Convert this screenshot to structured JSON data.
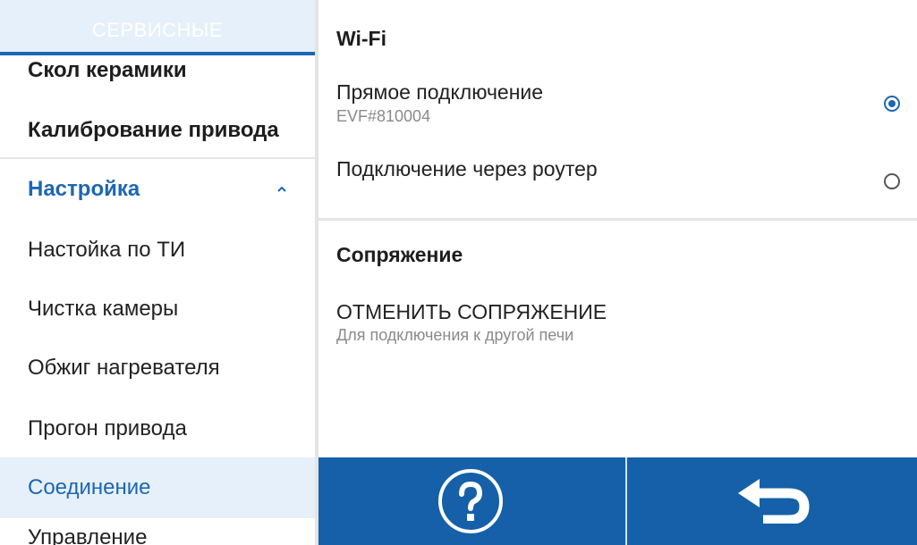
{
  "sidebar": {
    "header": "СЕРВИСНЫЕ",
    "items": [
      {
        "label": "Скол керамики"
      },
      {
        "label": "Калибрование привода"
      },
      {
        "label": "Настройка"
      },
      {
        "label": "Настойка по ТИ"
      },
      {
        "label": "Чистка камеры"
      },
      {
        "label": "Обжиг нагревателя"
      },
      {
        "label": "Прогон привода"
      },
      {
        "label": "Соединение"
      },
      {
        "label": "Управление"
      }
    ]
  },
  "main": {
    "wifi": {
      "title": "Wi-Fi",
      "options": [
        {
          "title": "Прямое подключение",
          "subtitle": "EVF#810004",
          "selected": true
        },
        {
          "title": "Подключение через роутер",
          "subtitle": "",
          "selected": false
        }
      ]
    },
    "pairing": {
      "title": "Сопряжение",
      "action": "ОТМЕНИТЬ СОПРЯЖЕНИЕ",
      "action_sub": "Для подключения к другой печи"
    }
  },
  "bottom_bar": {
    "help_icon": "question-circle-icon",
    "back_icon": "back-arrow-icon"
  },
  "colors": {
    "accent": "#1b67b1",
    "bar": "#1560a8",
    "active_bg": "#e6f0fa"
  }
}
